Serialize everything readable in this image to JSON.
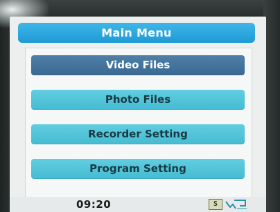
{
  "main_menu": {
    "title": "Main Menu",
    "items": [
      {
        "label": "Video Files",
        "selected": true
      },
      {
        "label": "Photo Files",
        "selected": false
      },
      {
        "label": "Recorder Setting",
        "selected": false
      },
      {
        "label": "Program Setting",
        "selected": false
      }
    ]
  },
  "status_bar": {
    "time": "09:20",
    "mode_icon_text": "S",
    "icons": [
      "mode-s-icon",
      "recorder-icon"
    ]
  },
  "colors": {
    "title_bar": "#1e9ad6",
    "menu_item": "#45bcd2",
    "menu_item_selected": "#3a6a93",
    "screen_background": "#ecefee"
  }
}
